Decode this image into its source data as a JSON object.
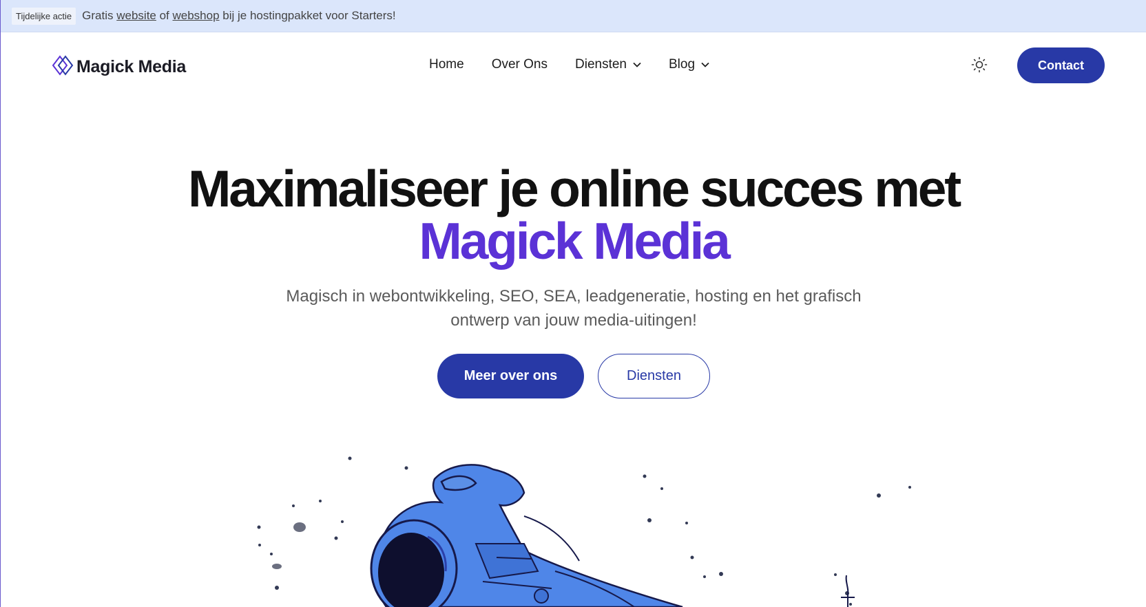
{
  "announcement": {
    "badge": "Tijdelijke actie",
    "text_before": "Gratis ",
    "link_website": "website",
    "text_of": " of ",
    "link_webshop": "webshop",
    "text_after": " bij je hostingpakket voor Starters!"
  },
  "header": {
    "brand": "Magick Media",
    "nav": [
      {
        "label": "Home",
        "dropdown": false
      },
      {
        "label": "Over Ons",
        "dropdown": false
      },
      {
        "label": "Diensten",
        "dropdown": true
      },
      {
        "label": "Blog",
        "dropdown": true
      }
    ],
    "theme_icon": "sun-icon",
    "contact_label": "Contact"
  },
  "hero": {
    "title_line1": "Maximaliseer je online succes met",
    "title_line2": "Magick Media",
    "subtitle": "Magisch in webontwikkeling, SEO, SEA, leadgeneratie, hosting en het grafisch ontwerp van jouw media-uitingen!",
    "primary_cta": "Meer over ons",
    "secondary_cta": "Diensten"
  },
  "colors": {
    "announcement_bg": "#dbe6fb",
    "primary": "#2839a6",
    "accent": "#5b32d6",
    "astronaut_blue": "#4f86e8"
  },
  "illustration": {
    "icon": "astronaut-illustration"
  }
}
